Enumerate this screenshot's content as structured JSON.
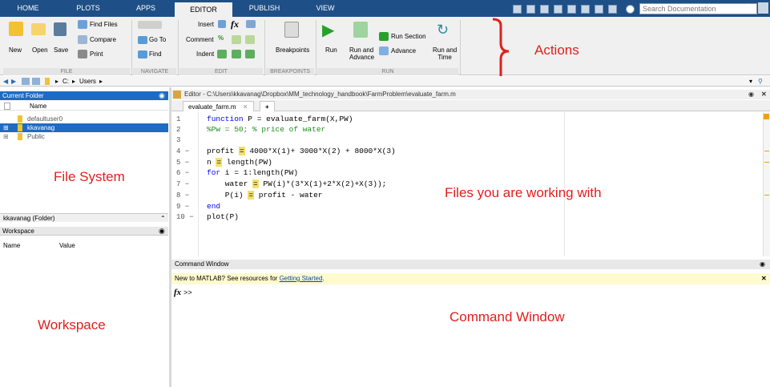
{
  "tabs": [
    "HOME",
    "PLOTS",
    "APPS",
    "EDITOR",
    "PUBLISH",
    "VIEW"
  ],
  "search": {
    "placeholder": "Search Documentation"
  },
  "ribbon": {
    "file": {
      "new": "New",
      "open": "Open",
      "save": "Save",
      "find_files": "Find Files",
      "compare": "Compare",
      "print": "Print",
      "label": "FILE"
    },
    "navigate": {
      "goto": "Go To",
      "find": "Find",
      "label": "NAVIGATE"
    },
    "edit": {
      "insert": "Insert",
      "comment": "Comment",
      "indent": "Indent",
      "label": "EDIT"
    },
    "breakpoints": {
      "breakpoints": "Breakpoints",
      "label": "BREAKPOINTS"
    },
    "run": {
      "run": "Run",
      "run_advance_1": "Run and",
      "run_advance_2": "Advance",
      "run_section": "Run Section",
      "advance": "Advance",
      "run_time_1": "Run and",
      "run_time_2": "Time",
      "label": "RUN"
    }
  },
  "annotations": {
    "actions": "Actions",
    "file_system": "File System",
    "files_working": "Files you are working with",
    "workspace": "Workspace",
    "command_window": "Command Window"
  },
  "address": {
    "drive": "C:",
    "folder": "Users"
  },
  "current_folder": {
    "title": "Current Folder",
    "column": "Name",
    "items": [
      "defaultuser0",
      "kkavanag",
      "Public"
    ],
    "selected": "kkavanag (Folder)"
  },
  "workspace": {
    "title": "Workspace",
    "col_name": "Name",
    "col_value": "Value"
  },
  "editor": {
    "path": "Editor - C:\\Users\\kkavanag\\Dropbox\\MM_technology_handbook\\FarmProblem\\evaluate_farm.m",
    "tab": "evaluate_farm.m",
    "line_numbers": [
      "1",
      "2",
      "3",
      "4 −",
      "5 −",
      "6 −",
      "7 −",
      "8 −",
      "9 −",
      "10 −"
    ],
    "code": [
      "function P = evaluate_farm(X,PW)",
      "%Pw = 50; % price of water",
      "",
      "profit = 4000*X(1)+ 3000*X(2) + 8000*X(3)",
      "n = length(PW)",
      "for i = 1:length(PW)",
      "    water = PW(i)*(3*X(1)+2*X(2)+X(3));",
      "    P(i) = profit - water",
      "end",
      "plot(P)"
    ]
  },
  "command_window": {
    "title": "Command Window",
    "banner_text": "New to MATLAB? See resources for ",
    "banner_link": "Getting Started",
    "prompt": ">>"
  },
  "colors": {
    "annotation": "#e0201c",
    "tabbar": "#1e4f86",
    "selection": "#1e6bc2"
  }
}
